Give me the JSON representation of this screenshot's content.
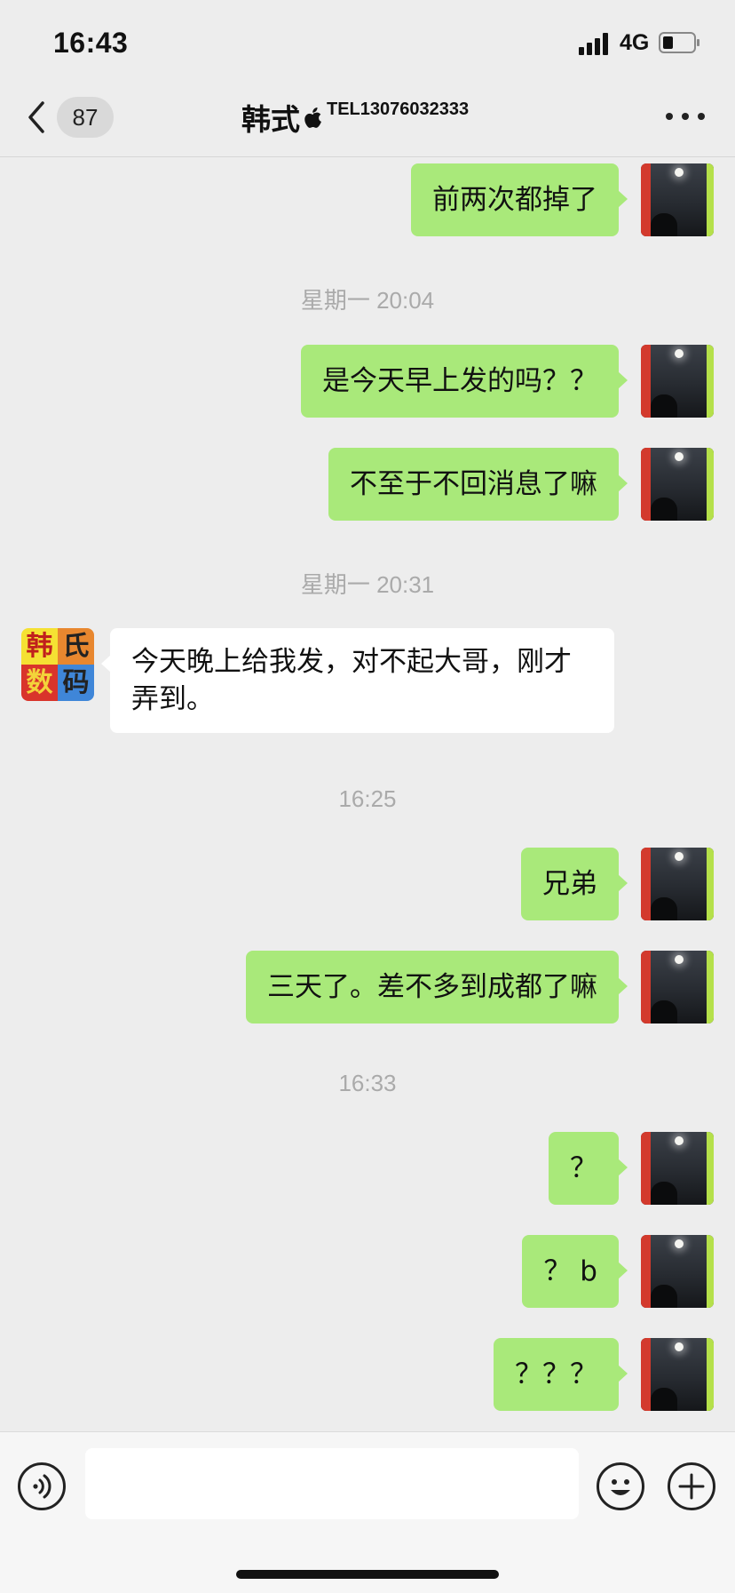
{
  "status_bar": {
    "time": "16:43",
    "network": "4G",
    "battery_level": 0.35
  },
  "nav": {
    "unread_count": "87",
    "title_name": "韩式",
    "title_tel": "TEL13076032333"
  },
  "messages": [
    {
      "type": "me",
      "text": "前两次都掉了"
    },
    {
      "type": "time",
      "text": "星期一 20:04"
    },
    {
      "type": "me",
      "text": "是今天早上发的吗？？"
    },
    {
      "type": "me",
      "text": "不至于不回消息了嘛"
    },
    {
      "type": "time",
      "text": "星期一 20:31"
    },
    {
      "type": "them",
      "text": "今天晚上给我发，对不起大哥，刚才弄到。"
    },
    {
      "type": "time",
      "text": "16:25"
    },
    {
      "type": "me",
      "text": "兄弟"
    },
    {
      "type": "me",
      "text": "三天了。差不多到成都了嘛"
    },
    {
      "type": "time",
      "text": "16:33"
    },
    {
      "type": "me",
      "text": "？"
    },
    {
      "type": "me",
      "text": "？ b"
    },
    {
      "type": "me",
      "text": "？？？"
    }
  ],
  "contact_avatar": {
    "chars": [
      "韩",
      "氏",
      "数",
      "码"
    ],
    "colors": [
      "#f5e133",
      "#e8872f",
      "#d9342b",
      "#3f86d8"
    ]
  },
  "colors": {
    "my_bubble": "#a9e97a",
    "their_bubble": "#ffffff",
    "background": "#ededed"
  },
  "input": {
    "value": ""
  }
}
